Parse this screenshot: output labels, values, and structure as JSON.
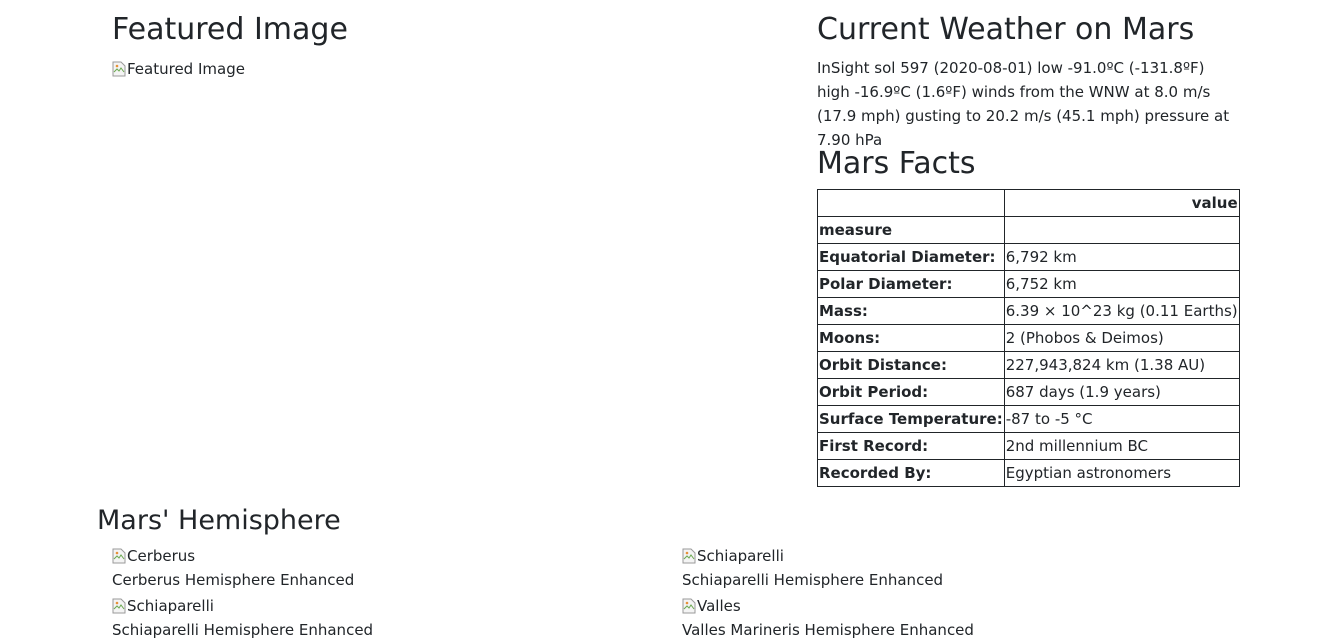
{
  "featured": {
    "heading": "Featured Image",
    "image_alt": "Featured Image"
  },
  "weather": {
    "heading": "Current Weather on Mars",
    "text": "InSight sol 597 (2020-08-01) low -91.0ºC (-131.8ºF) high -16.9ºC (1.6ºF) winds from the WNW at 8.0 m/s (17.9 mph) gusting to 20.2 m/s (45.1 mph) pressure at 7.90 hPa"
  },
  "facts": {
    "heading": "Mars Facts",
    "column_header": "value",
    "index_header": "measure",
    "rows": [
      {
        "label": "Equatorial Diameter:",
        "value": "6,792 km"
      },
      {
        "label": "Polar Diameter:",
        "value": "6,752 km"
      },
      {
        "label": "Mass:",
        "value": "6.39 × 10^23 kg (0.11 Earths)"
      },
      {
        "label": "Moons:",
        "value": "2 (Phobos & Deimos)"
      },
      {
        "label": "Orbit Distance:",
        "value": "227,943,824 km (1.38 AU)"
      },
      {
        "label": "Orbit Period:",
        "value": "687 days (1.9 years)"
      },
      {
        "label": "Surface Temperature:",
        "value": "-87 to -5 °C"
      },
      {
        "label": "First Record:",
        "value": "2nd millennium BC"
      },
      {
        "label": "Recorded By:",
        "value": "Egyptian astronomers"
      }
    ]
  },
  "hemispheres": {
    "heading": "Mars' Hemisphere",
    "items": [
      {
        "alt": "Cerberus",
        "caption": "Cerberus Hemisphere Enhanced"
      },
      {
        "alt": "Schiaparelli",
        "caption": "Schiaparelli Hemisphere Enhanced"
      },
      {
        "alt": "Schiaparelli",
        "caption": "Schiaparelli Hemisphere Enhanced"
      },
      {
        "alt": "Valles",
        "caption": "Valles Marineris Hemisphere Enhanced"
      }
    ]
  }
}
